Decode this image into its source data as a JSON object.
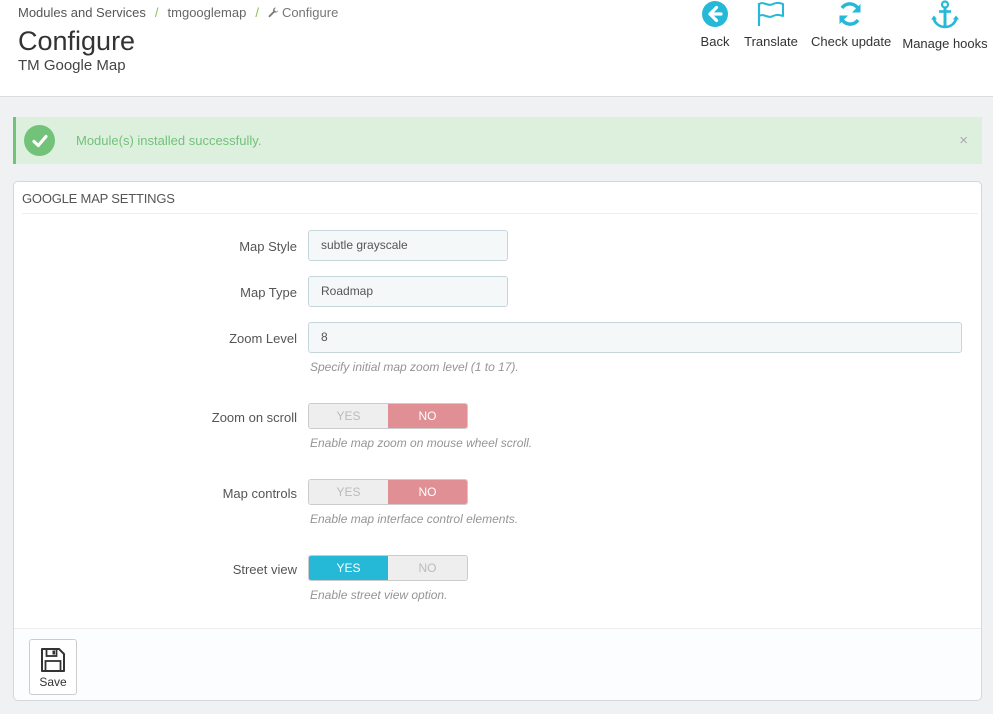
{
  "breadcrumb": {
    "root": "Modules and Services",
    "module": "tmgooglemap",
    "current": "Configure"
  },
  "header": {
    "title": "Configure",
    "subtitle": "TM Google Map"
  },
  "toolbar": {
    "back": "Back",
    "translate": "Translate",
    "check_update": "Check update",
    "manage_hooks": "Manage hooks"
  },
  "alert": {
    "message": "Module(s) installed successfully.",
    "close": "×"
  },
  "panel": {
    "heading": "Google map settings",
    "map_style": {
      "label": "Map Style",
      "value": "subtle grayscale"
    },
    "map_type": {
      "label": "Map Type",
      "value": "Roadmap"
    },
    "zoom_level": {
      "label": "Zoom Level",
      "value": "8",
      "help": "Specify initial map zoom level (1 to 17)."
    },
    "zoom_on_scroll": {
      "label": "Zoom on scroll",
      "yes": "YES",
      "no": "NO",
      "selected": "NO",
      "help": "Enable map zoom on mouse wheel scroll."
    },
    "map_controls": {
      "label": "Map controls",
      "yes": "YES",
      "no": "NO",
      "selected": "NO",
      "help": "Enable map interface control elements."
    },
    "street_view": {
      "label": "Street view",
      "yes": "YES",
      "no": "NO",
      "selected": "YES",
      "help": "Enable street view option."
    },
    "save": "Save"
  },
  "colors": {
    "accent": "#25b9d7",
    "success": "#72c279",
    "no_active": "#e08f95"
  },
  "icons": {
    "back": "back-arrow-circle-icon",
    "translate": "flag-icon",
    "check_update": "refresh-icon",
    "manage_hooks": "anchor-icon",
    "alert": "check-circle-icon",
    "save": "floppy-disk-icon",
    "breadcrumb_current": "wrench-icon"
  }
}
